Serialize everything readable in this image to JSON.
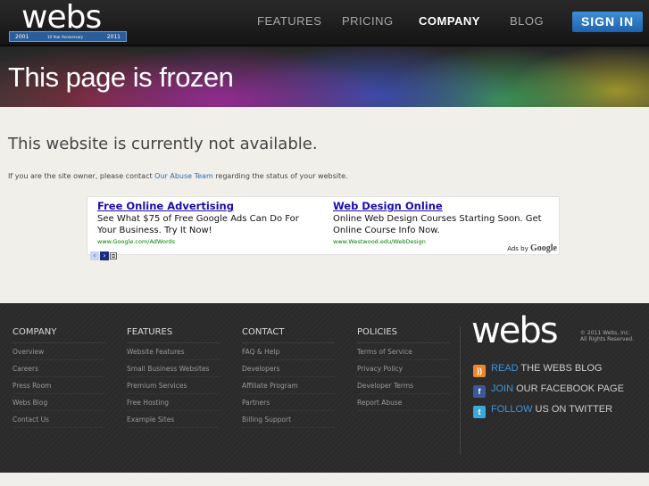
{
  "header": {
    "logo_text": "webs",
    "ribbon": {
      "left": "2001",
      "mid": "10 Year Anniversary",
      "right": "2011"
    },
    "nav": [
      {
        "label": "FEATURES"
      },
      {
        "label": "PRICING"
      },
      {
        "label": "COMPANY",
        "active": true
      },
      {
        "label": "BLOG"
      }
    ],
    "sign_in": "SIGN IN"
  },
  "hero": {
    "title": "This page is frozen"
  },
  "content": {
    "heading": "This website is currently not available.",
    "note_prefix": "If you are the site owner, please contact ",
    "note_link": "Our Abuse Team",
    "note_suffix": " regarding the status of your website."
  },
  "ads": {
    "items": [
      {
        "title": "Free Online Advertising",
        "text": "See What $75 of Free Google Ads Can Do For Your Business. Try It Now!",
        "url": "www.Google.com/AdWords"
      },
      {
        "title": "Web Design Online",
        "text": "Online Web Design Courses Starting Soon. Get Online Course Info Now.",
        "url": "www.Westwood.edu/WebDesign"
      }
    ],
    "ads_by": "Ads by",
    "ads_by_brand": "Google"
  },
  "footer": {
    "columns": [
      {
        "heading": "COMPANY",
        "links": [
          "Overview",
          "Careers",
          "Press Room",
          "Webs Blog",
          "Contact Us"
        ]
      },
      {
        "heading": "FEATURES",
        "links": [
          "Website Features",
          "Small Business Websites",
          "Premium Services",
          "Free Hosting",
          "Example Sites"
        ]
      },
      {
        "heading": "CONTACT",
        "links": [
          "FAQ & Help",
          "Developers",
          "Affiliate Program",
          "Partners",
          "Billing Support"
        ]
      },
      {
        "heading": "POLICIES",
        "links": [
          "Terms of Service",
          "Privacy Policy",
          "Developer Terms",
          "Report Abuse"
        ]
      }
    ],
    "brand": "webs",
    "copyright": "© 2011 Webs, Inc. All Rights Reserved.",
    "social": [
      {
        "action": "READ",
        "text": " THE WEBS BLOG",
        "icon": "rss-icon"
      },
      {
        "action": "JOIN",
        "text": " OUR FACEBOOK PAGE",
        "icon": "facebook-icon"
      },
      {
        "action": "FOLLOW",
        "text": " US ON TWITTER",
        "icon": "twitter-icon"
      }
    ]
  }
}
